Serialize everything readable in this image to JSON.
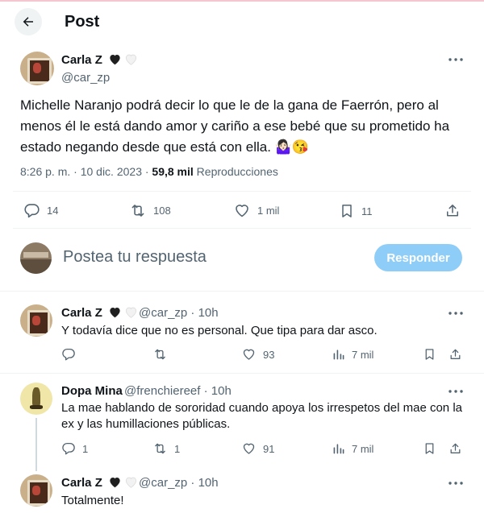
{
  "header": {
    "title": "Post"
  },
  "post": {
    "author_name": "Carla Z",
    "author_handle": "@car_zp",
    "text": "Michelle Naranjo podrá decir lo que le de la gana de Faerrón, pero al menos él le está dando amor y cariño a ese bebé que su prometido ha estado negando desde que está con ella. 🤷🏻‍♀️😘",
    "time": "8:26 p. m. · 10 dic. 2023 · ",
    "views_count": "59,8 mil",
    "views_label": " Reproducciones",
    "stats": {
      "replies": "14",
      "reposts": "108",
      "likes": "1 mil",
      "bookmarks": "11"
    }
  },
  "composer": {
    "placeholder": "Postea tu respuesta",
    "button_label": "Responder"
  },
  "replies": [
    {
      "author_name": "Carla Z",
      "author_handle": "@car_zp · 10h",
      "text": "Y todavía dice que no es personal. Que tipa para dar asco.",
      "stats": {
        "replies": "",
        "reposts": "",
        "likes": "93",
        "views": "7 mil"
      }
    },
    {
      "author_name": "Dopa Mina",
      "author_handle": "@frenchiereef · 10h",
      "text": "La mae hablando de sororidad cuando apoya los irrespetos del mae con la ex y las humillaciones públicas.",
      "stats": {
        "replies": "1",
        "reposts": "1",
        "likes": "91",
        "views": "7 mil"
      }
    },
    {
      "author_name": "Carla Z",
      "author_handle": "@car_zp · 10h",
      "text": "Totalmente!"
    }
  ],
  "colors": {
    "accent_disabled": "#8ecdf7",
    "muted": "#536471",
    "divider": "#eff3f4"
  },
  "icons": [
    "back-arrow-icon",
    "black-heart-icon",
    "white-heart-icon",
    "more-icon",
    "reply-icon",
    "repost-icon",
    "like-icon",
    "bookmark-icon",
    "share-icon",
    "views-icon"
  ]
}
